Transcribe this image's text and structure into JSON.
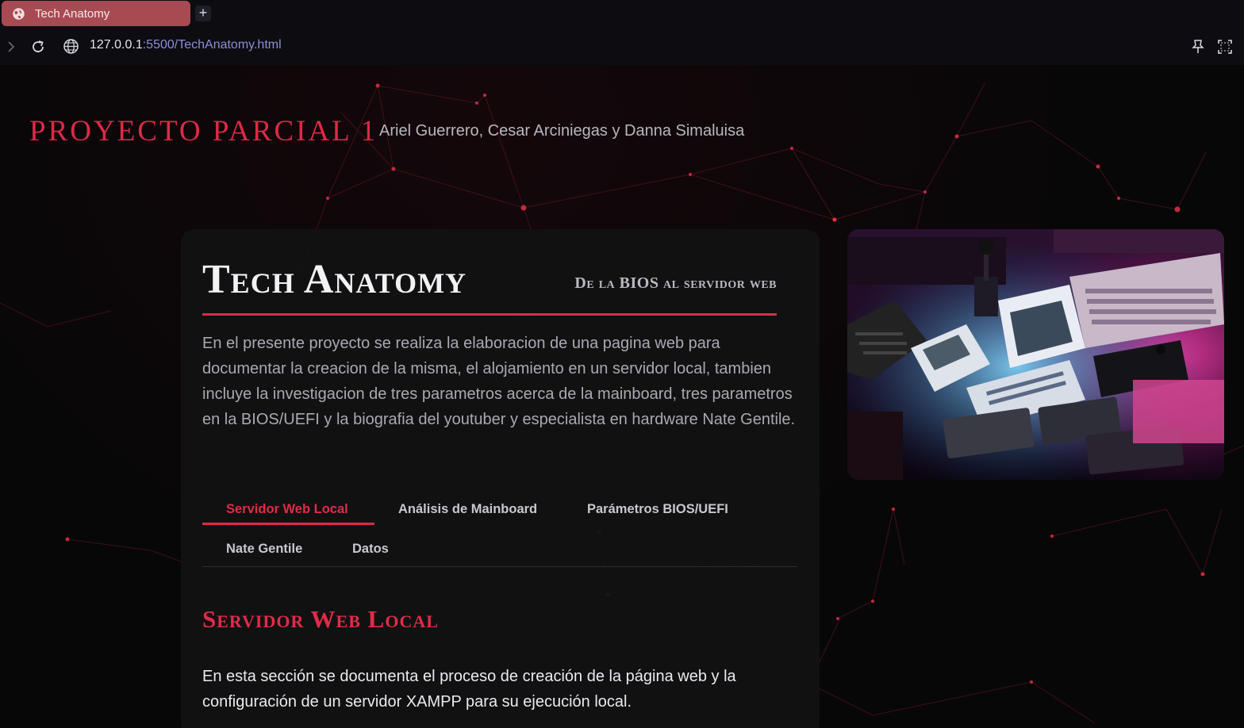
{
  "browser": {
    "tab_title": "Tech Anatomy",
    "new_tab_label": "+",
    "url_host": "127.0.0.1",
    "url_path": ":5500/TechAnatomy.html"
  },
  "header": {
    "site_title": "PROYECTO PARCIAL 1",
    "authors": "Ariel Guerrero, Cesar Arciniegas y Danna Simaluisa"
  },
  "card": {
    "title": "Tech Anatomy",
    "subtitle": "De la BIOS al servidor web",
    "intro": "En el presente proyecto se realiza la elaboracion de una pagina web para documentar la creacion de la misma, el alojamiento en un servidor local, tambien incluye la investigacion de tres parametros acerca de la mainboard, tres parametros en la BIOS/UEFI y la biografia del youtuber y especialista en hardware Nate Gentile.",
    "tabs": [
      {
        "label": "Servidor Web Local",
        "active": true
      },
      {
        "label": "Análisis de Mainboard",
        "active": false
      },
      {
        "label": "Parámetros BIOS/UEFI",
        "active": false
      },
      {
        "label": "Nate Gentile",
        "active": false
      },
      {
        "label": "Datos",
        "active": false
      }
    ],
    "section_title": "Servidor Web Local",
    "section_text": "En esta sección se documenta el proceso de creación de la página web y la configuración de un servidor XAMPP para su ejecución local."
  },
  "colors": {
    "accent": "#dd2a46",
    "background": "#070708",
    "card": "#121214",
    "tab_active_bg": "#a84a52"
  },
  "icons": [
    "globe-icon",
    "forward-icon",
    "reload-icon",
    "site-info-icon",
    "pin-icon",
    "screenshot-icon"
  ]
}
